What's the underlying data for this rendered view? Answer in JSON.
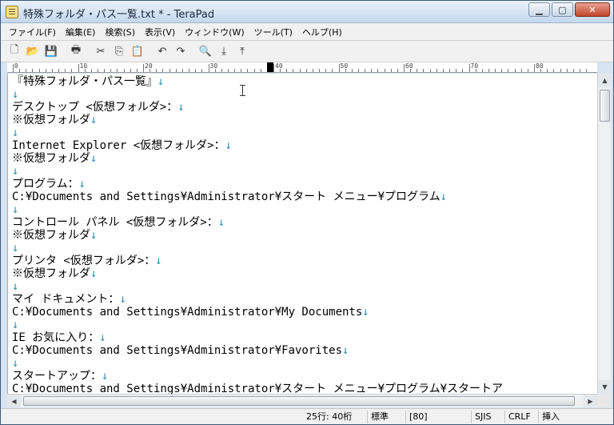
{
  "window": {
    "title": "特殊フォルダ・パス一覧.txt * - TeraPad"
  },
  "menu": [
    "ファイル(F)",
    "編集(E)",
    "検索(S)",
    "表示(V)",
    "ウィンドウ(W)",
    "ツール(T)",
    "ヘルプ(H)"
  ],
  "toolbar_icons": [
    "new-file-icon",
    "open-folder-icon",
    "save-icon",
    "print-icon",
    "cut-icon",
    "copy-icon",
    "paste-icon",
    "undo-icon",
    "redo-icon",
    "find-icon",
    "find-next-icon",
    "find-prev-icon"
  ],
  "ruler": {
    "labels": [
      "0",
      "10",
      "20",
      "30",
      "40",
      "50",
      "60",
      "70",
      "80"
    ]
  },
  "eol_mark": "↓",
  "lines": [
    "『特殊フォルダ・パス一覧』",
    "",
    "デスクトップ <仮想フォルダ>：",
    "※仮想フォルダ",
    "",
    "Internet Explorer <仮想フォルダ>：",
    "※仮想フォルダ",
    "",
    "プログラム：",
    "C:¥Documents and Settings¥Administrator¥スタート メニュー¥プログラム",
    "",
    "コントロール パネル <仮想フォルダ>：",
    "※仮想フォルダ",
    "",
    "プリンタ <仮想フォルダ>：",
    "※仮想フォルダ",
    "",
    "マイ ドキュメント：",
    "C:¥Documents and Settings¥Administrator¥My Documents",
    "",
    "IE お気に入り：",
    "C:¥Documents and Settings¥Administrator¥Favorites",
    "",
    "スタートアップ：",
    "C:¥Documents and Settings¥Administrator¥スタート メニュー¥プログラム¥スタートア"
  ],
  "status": {
    "position": "25行: 40桁",
    "mode": "標準",
    "code": "[80]",
    "encoding": "SJIS",
    "newline": "CRLF",
    "insert": "挿入"
  }
}
